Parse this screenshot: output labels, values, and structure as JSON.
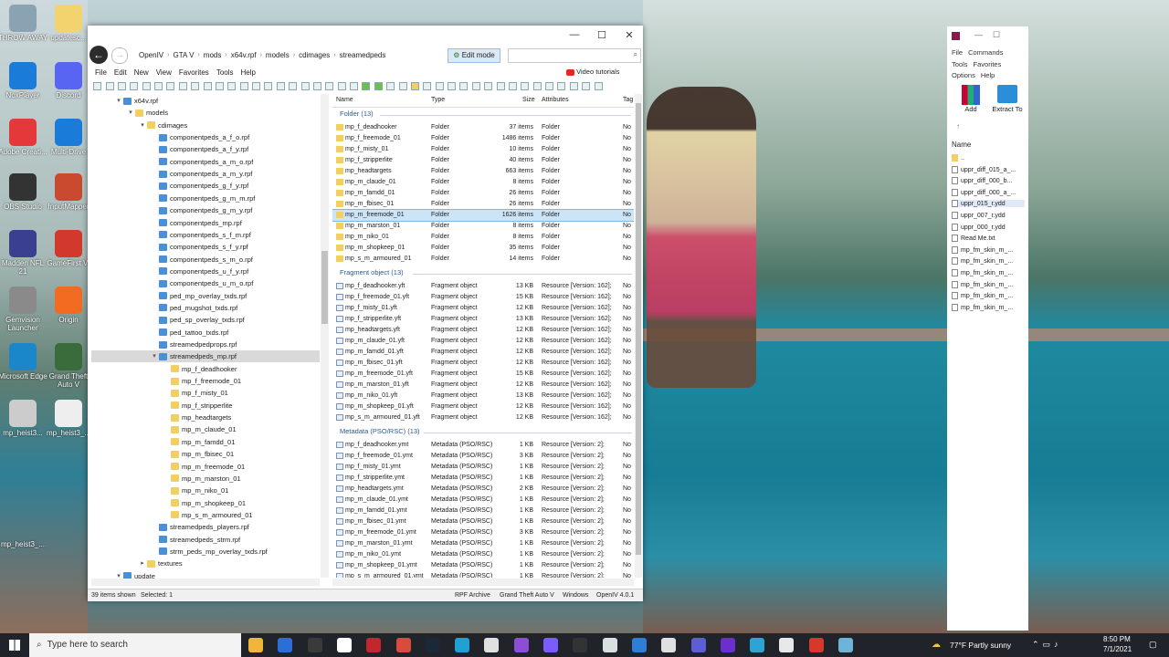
{
  "desktop": {
    "icons": [
      {
        "label": "THROW AWAY",
        "color": "#8aa3b3"
      },
      {
        "label": "NoxPlayer",
        "color": "#1a7bd8"
      },
      {
        "label": "Adobe Creati...",
        "color": "#e5383b"
      },
      {
        "label": "OBS Studio",
        "color": "#333333"
      },
      {
        "label": "Madden NFL 21",
        "color": "#3a3f8f"
      },
      {
        "label": "Gemvision Launcher",
        "color": "#8a8a8a"
      },
      {
        "label": "Microsoft Edge",
        "color": "#1b86c9"
      },
      {
        "label": "mp_heist3...",
        "color": "#cccccc"
      },
      {
        "label": "updatesc...",
        "color": "#f3d36d"
      },
      {
        "label": "Discord",
        "color": "#5865f2"
      },
      {
        "label": "Multi-Drive",
        "color": "#1a7bd8"
      },
      {
        "label": "InputMapper",
        "color": "#c94a2e"
      },
      {
        "label": "GameFirst VI",
        "color": "#d0392b"
      },
      {
        "label": "Origin",
        "color": "#f26b21"
      },
      {
        "label": "Grand Theft Auto V",
        "color": "#3a6b3a"
      },
      {
        "label": "mp_heist3_...",
        "color": "#eeeeee"
      }
    ],
    "bottom_labels": [
      "mp_heist3_..."
    ]
  },
  "openiv": {
    "title_controls": [
      "—",
      "☐",
      "✕"
    ],
    "breadcrumb": [
      "OpenIV",
      "GTA V",
      "mods",
      "x64v.rpf",
      "models",
      "cdimages",
      "streamedpeds"
    ],
    "edit_mode": "Edit mode",
    "menu": [
      "File",
      "Edit",
      "New",
      "View",
      "Favorites",
      "Tools",
      "Help"
    ],
    "video_tutorials": "Video tutorials",
    "tree": [
      {
        "label": "x64v.rpf",
        "indent": 0,
        "type": "rpf",
        "arrow": "▾"
      },
      {
        "label": "models",
        "indent": 1,
        "type": "folder",
        "arrow": "▾"
      },
      {
        "label": "cdimages",
        "indent": 2,
        "type": "folder",
        "arrow": "▾"
      },
      {
        "label": "componentpeds_a_f_o.rpf",
        "indent": 3,
        "type": "rpf"
      },
      {
        "label": "componentpeds_a_f_y.rpf",
        "indent": 3,
        "type": "rpf"
      },
      {
        "label": "componentpeds_a_m_o.rpf",
        "indent": 3,
        "type": "rpf"
      },
      {
        "label": "componentpeds_a_m_y.rpf",
        "indent": 3,
        "type": "rpf"
      },
      {
        "label": "componentpeds_g_f_y.rpf",
        "indent": 3,
        "type": "rpf"
      },
      {
        "label": "componentpeds_g_m_m.rpf",
        "indent": 3,
        "type": "rpf"
      },
      {
        "label": "componentpeds_g_m_y.rpf",
        "indent": 3,
        "type": "rpf"
      },
      {
        "label": "componentpeds_mp.rpf",
        "indent": 3,
        "type": "rpf"
      },
      {
        "label": "componentpeds_s_f_m.rpf",
        "indent": 3,
        "type": "rpf"
      },
      {
        "label": "componentpeds_s_f_y.rpf",
        "indent": 3,
        "type": "rpf"
      },
      {
        "label": "componentpeds_s_m_o.rpf",
        "indent": 3,
        "type": "rpf"
      },
      {
        "label": "componentpeds_u_f_y.rpf",
        "indent": 3,
        "type": "rpf"
      },
      {
        "label": "componentpeds_u_m_o.rpf",
        "indent": 3,
        "type": "rpf"
      },
      {
        "label": "ped_mp_overlay_txds.rpf",
        "indent": 3,
        "type": "rpf"
      },
      {
        "label": "ped_mugshot_txds.rpf",
        "indent": 3,
        "type": "rpf"
      },
      {
        "label": "ped_sp_overlay_txds.rpf",
        "indent": 3,
        "type": "rpf"
      },
      {
        "label": "ped_tattoo_txds.rpf",
        "indent": 3,
        "type": "rpf"
      },
      {
        "label": "streamedpedprops.rpf",
        "indent": 3,
        "type": "rpf"
      },
      {
        "label": "streamedpeds_mp.rpf",
        "indent": 3,
        "type": "rpf",
        "arrow": "▾",
        "selected": true
      },
      {
        "label": "mp_f_deadhooker",
        "indent": 4,
        "type": "folder"
      },
      {
        "label": "mp_f_freemode_01",
        "indent": 4,
        "type": "folder"
      },
      {
        "label": "mp_f_misty_01",
        "indent": 4,
        "type": "folder"
      },
      {
        "label": "mp_f_stripperlite",
        "indent": 4,
        "type": "folder"
      },
      {
        "label": "mp_headtargets",
        "indent": 4,
        "type": "folder"
      },
      {
        "label": "mp_m_claude_01",
        "indent": 4,
        "type": "folder"
      },
      {
        "label": "mp_m_famdd_01",
        "indent": 4,
        "type": "folder"
      },
      {
        "label": "mp_m_fbisec_01",
        "indent": 4,
        "type": "folder"
      },
      {
        "label": "mp_m_freemode_01",
        "indent": 4,
        "type": "folder"
      },
      {
        "label": "mp_m_marston_01",
        "indent": 4,
        "type": "folder"
      },
      {
        "label": "mp_m_niko_01",
        "indent": 4,
        "type": "folder"
      },
      {
        "label": "mp_m_shopkeep_01",
        "indent": 4,
        "type": "folder"
      },
      {
        "label": "mp_s_m_armoured_01",
        "indent": 4,
        "type": "folder"
      },
      {
        "label": "streamedpeds_players.rpf",
        "indent": 3,
        "type": "rpf"
      },
      {
        "label": "streamedpeds_strm.rpf",
        "indent": 3,
        "type": "rpf"
      },
      {
        "label": "strm_peds_mp_overlay_txds.rpf",
        "indent": 3,
        "type": "rpf"
      },
      {
        "label": "textures",
        "indent": 2,
        "type": "folder",
        "arrow": "▸"
      },
      {
        "label": "update",
        "indent": 0,
        "type": "rpf",
        "arrow": "▾"
      }
    ],
    "columns": [
      "Name",
      "Type",
      "Size",
      "Attributes",
      "Tag"
    ],
    "groups": [
      {
        "title": "Folder (13)",
        "icon": "folder",
        "type": "Folder",
        "attr": "Folder",
        "tag": "No",
        "rows": [
          [
            "mp_f_deadhooker",
            "37 items"
          ],
          [
            "mp_f_freemode_01",
            "1486 items"
          ],
          [
            "mp_f_misty_01",
            "10 items"
          ],
          [
            "mp_f_stripperlite",
            "40 items"
          ],
          [
            "mp_headtargets",
            "663 items"
          ],
          [
            "mp_m_claude_01",
            "8 items"
          ],
          [
            "mp_m_famdd_01",
            "26 items"
          ],
          [
            "mp_m_fbisec_01",
            "26 items"
          ],
          [
            "mp_m_freemode_01",
            "1626 items"
          ],
          [
            "mp_m_marston_01",
            "8 items"
          ],
          [
            "mp_m_niko_01",
            "8 items"
          ],
          [
            "mp_m_shopkeep_01",
            "35 items"
          ],
          [
            "mp_s_m_armoured_01",
            "14 items"
          ]
        ]
      },
      {
        "title": "Fragment object (13)",
        "icon": "file",
        "type": "Fragment object",
        "attr": "Resource [Version: 162];",
        "tag": "No",
        "rows": [
          [
            "mp_f_deadhooker.yft",
            "13 KB"
          ],
          [
            "mp_f_freemode_01.yft",
            "15 KB"
          ],
          [
            "mp_f_misty_01.yft",
            "12 KB"
          ],
          [
            "mp_f_stripperlite.yft",
            "13 KB"
          ],
          [
            "mp_headtargets.yft",
            "12 KB"
          ],
          [
            "mp_m_claude_01.yft",
            "12 KB"
          ],
          [
            "mp_m_famdd_01.yft",
            "12 KB"
          ],
          [
            "mp_m_fbisec_01.yft",
            "12 KB"
          ],
          [
            "mp_m_freemode_01.yft",
            "15 KB"
          ],
          [
            "mp_m_marston_01.yft",
            "12 KB"
          ],
          [
            "mp_m_niko_01.yft",
            "13 KB"
          ],
          [
            "mp_m_shopkeep_01.yft",
            "12 KB"
          ],
          [
            "mp_s_m_armoured_01.yft",
            "12 KB"
          ]
        ]
      },
      {
        "title": "Metadata (PSO/RSC) (13)",
        "icon": "file",
        "type": "Metadata (PSO/RSC)",
        "attr": "Resource [Version: 2];",
        "tag": "No",
        "rows": [
          [
            "mp_f_deadhooker.ymt",
            "1 KB"
          ],
          [
            "mp_f_freemode_01.ymt",
            "3 KB"
          ],
          [
            "mp_f_misty_01.ymt",
            "1 KB"
          ],
          [
            "mp_f_stripperlite.ymt",
            "1 KB"
          ],
          [
            "mp_headtargets.ymt",
            "2 KB"
          ],
          [
            "mp_m_claude_01.ymt",
            "1 KB"
          ],
          [
            "mp_m_famdd_01.ymt",
            "1 KB"
          ],
          [
            "mp_m_fbisec_01.ymt",
            "1 KB"
          ],
          [
            "mp_m_freemode_01.ymt",
            "3 KB"
          ],
          [
            "mp_m_marston_01.ymt",
            "1 KB"
          ],
          [
            "mp_m_niko_01.ymt",
            "1 KB"
          ],
          [
            "mp_m_shopkeep_01.ymt",
            "1 KB"
          ],
          [
            "mp_s_m_armoured_01.ymt",
            "1 KB"
          ]
        ]
      }
    ],
    "selected_row": "mp_m_freemode_01",
    "status": {
      "items": "39 items shown",
      "selected": "Selected: 1",
      "archive": "RPF Archive",
      "game": "Grand Theft Auto V",
      "os": "Windows",
      "version": "OpenIV 4.0.1"
    }
  },
  "winrar": {
    "title_controls": [
      "—",
      "☐"
    ],
    "menu": [
      "File",
      "Commands",
      "Tools",
      "Favorites",
      "Options",
      "Help"
    ],
    "buttons": [
      "Add",
      "Extract To"
    ],
    "column": "Name",
    "files": [
      "..",
      "uppr_diff_015_a_...",
      "uppr_diff_000_b...",
      "uppr_diff_000_a_...",
      "uppr_015_r.ydd",
      "uppr_007_r.ydd",
      "uppr_000_r.ydd",
      "Read Me.txt",
      "mp_fm_skin_m_...",
      "mp_fm_skin_m_...",
      "mp_fm_skin_m_...",
      "mp_fm_skin_m_...",
      "mp_fm_skin_m_...",
      "mp_fm_skin_m_..."
    ]
  },
  "taskbar": {
    "search_placeholder": "Type here to search",
    "weather": "77°F  Partly sunny",
    "time": "8:50 PM",
    "date": "7/1/2021",
    "apps": [
      "#f2b53a",
      "#2a6fd6",
      "#3a3a3a",
      "#ffffff",
      "#c1272d",
      "#d94c3d",
      "#1b2838",
      "#1fa1d6",
      "#e0e0e0",
      "#8a4fd6",
      "#7a5cff",
      "#333",
      "#d9e0e0",
      "#2e7dd6",
      "#e0e0e0",
      "#5d5dd6",
      "#6b2fd0",
      "#2ea3d6",
      "#e8e8e8",
      "#d6392b",
      "#6fb3d6"
    ]
  }
}
